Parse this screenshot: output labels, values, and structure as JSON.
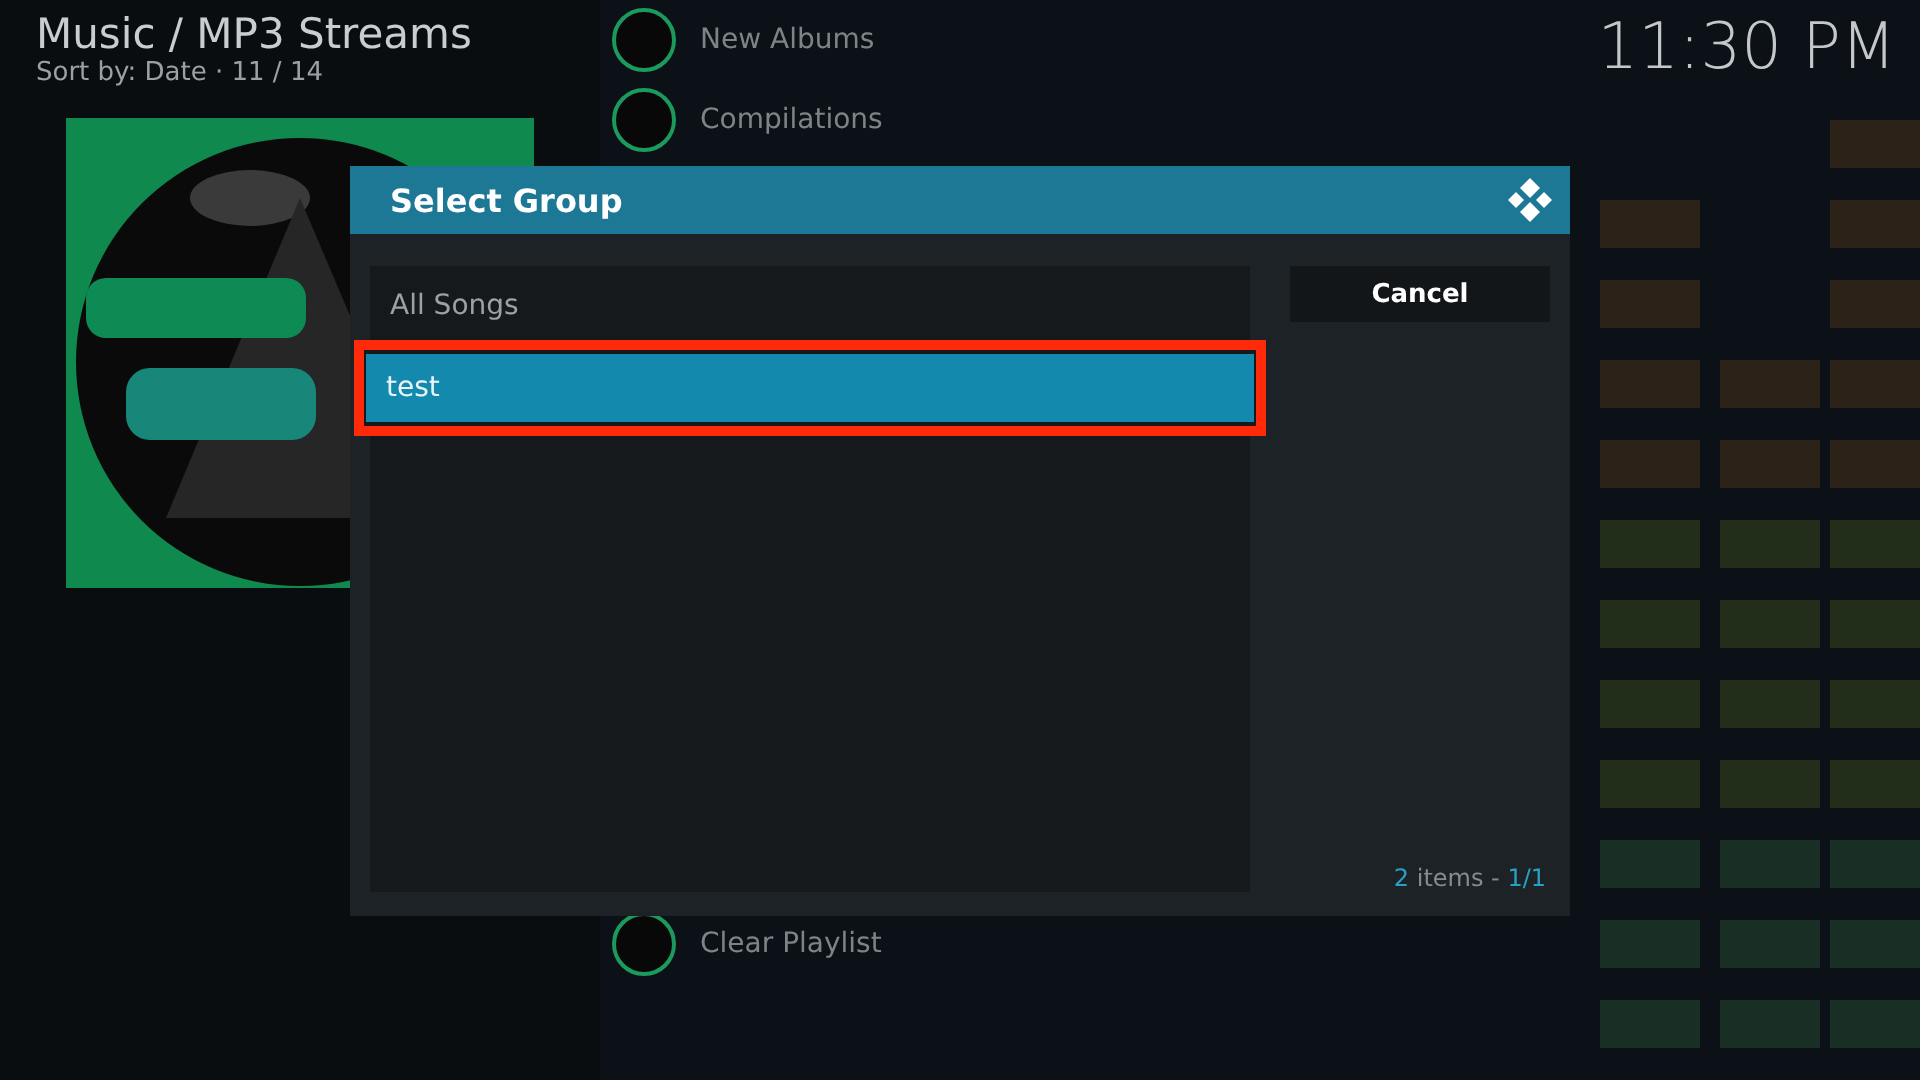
{
  "header": {
    "title": "Music / MP3 Streams",
    "subtitle": "Sort by: Date · 11 / 14"
  },
  "clock": "11:30 PM",
  "background_list": [
    {
      "label": "New Albums"
    },
    {
      "label": "Compilations"
    },
    {
      "label": "Clear Playlist"
    }
  ],
  "dialog": {
    "title": "Select Group",
    "items": [
      {
        "label": "All Songs",
        "selected": false,
        "highlighted": false
      },
      {
        "label": "test",
        "selected": true,
        "highlighted": true
      }
    ],
    "buttons": [
      "Cancel"
    ],
    "footer": {
      "count": "2",
      "text": "items -",
      "page": "1/1"
    }
  }
}
